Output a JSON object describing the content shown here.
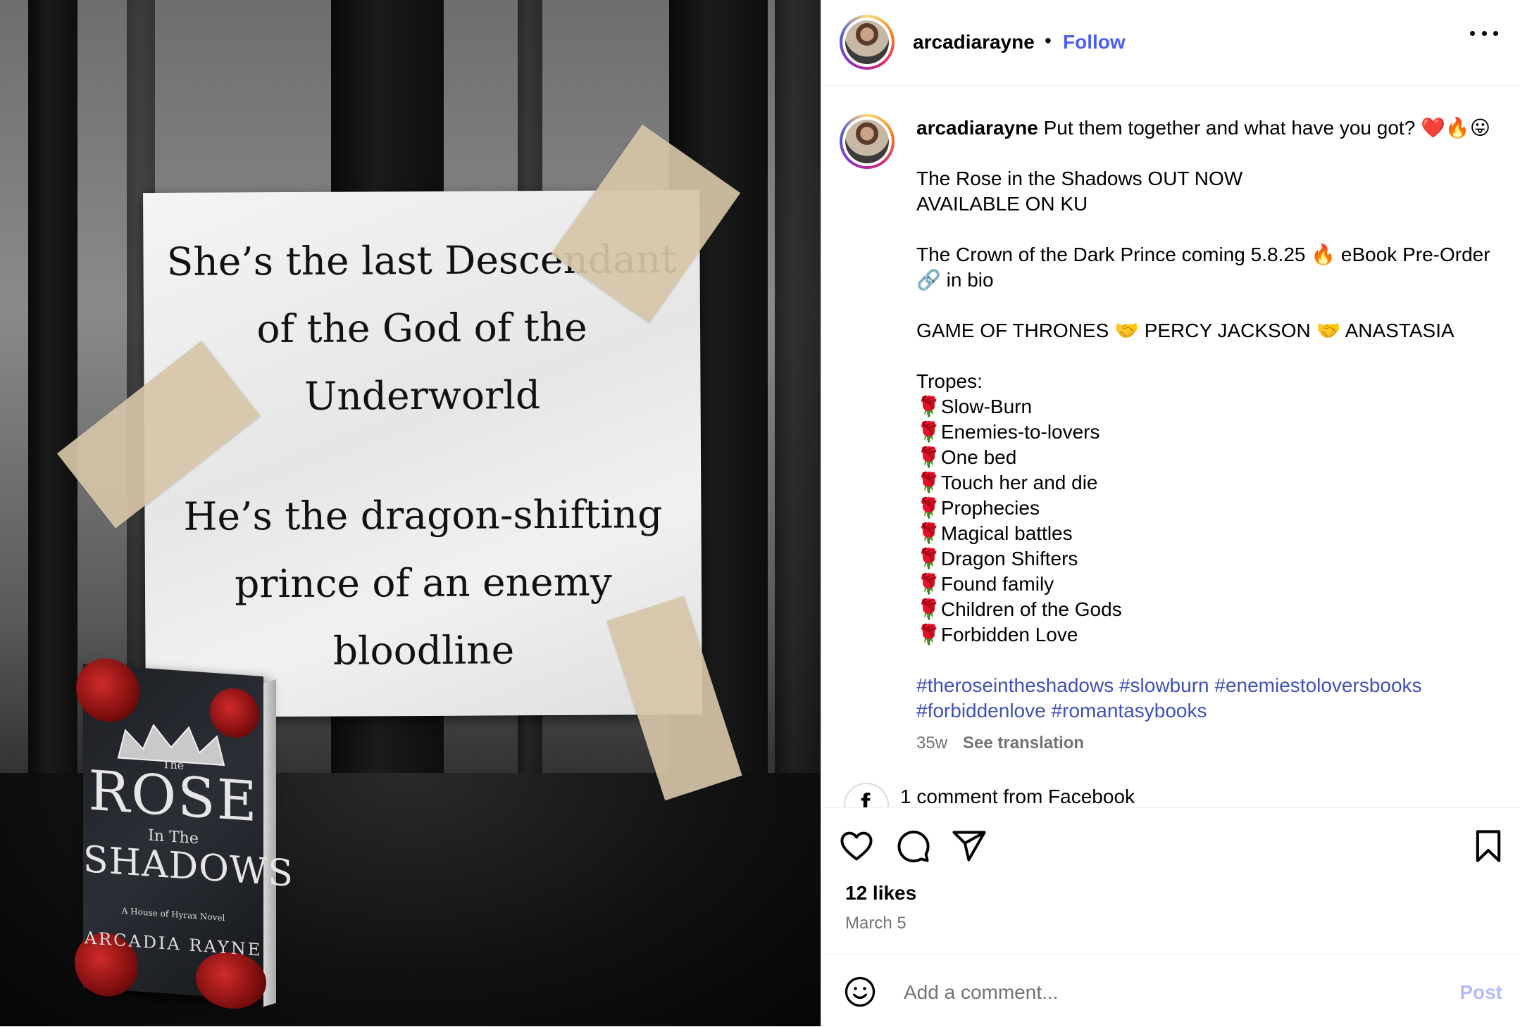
{
  "image": {
    "note_lines_1": "She’s the last Descendant\nof the God of the\nUnderworld",
    "note_lines_2": "He’s the dragon-shifting\nprince of an enemy\nbloodline",
    "book": {
      "title_top": "The",
      "title_main": "ROSE",
      "title_mid": "In The",
      "title_bottom": "SHADOWS",
      "subtitle": "A House of Hyrax Novel",
      "author": "ARCADIA RAYNE"
    }
  },
  "header": {
    "username": "arcadiarayne",
    "separator": "•",
    "follow_label": "Follow"
  },
  "caption": {
    "username": "arcadiarayne",
    "line_first": "Put them together and what have you got? ❤️🔥😛",
    "line_release_1": "The Rose in the Shadows OUT NOW",
    "line_release_2": "AVAILABLE ON KU",
    "line_crown": "The Crown of the Dark Prince coming 5.8.25 🔥 eBook Pre-Order 🔗 in bio",
    "line_comp": "GAME OF THRONES 🤝 PERCY JACKSON 🤝 ANASTASIA",
    "tropes_label": "Tropes:",
    "rose_emoji": "🌹",
    "tropes": [
      "Slow-Burn",
      "Enemies-to-lovers",
      "One bed",
      "Touch her and die",
      "Prophecies",
      "Magical battles",
      "Dragon Shifters",
      "Found family",
      "Children of the Gods",
      "Forbidden Love"
    ],
    "hashtags": "#theroseintheshadows #slowburn #enemiestoloversbooks #forbiddenlove #romantasybooks",
    "age": "35w",
    "see_translation": "See translation"
  },
  "facebook_comment": "1 comment from Facebook",
  "likes": "12 likes",
  "date": "March 5",
  "comment": {
    "placeholder": "Add a comment...",
    "post_label": "Post"
  },
  "colors": {
    "follow": "#4a5df9",
    "hashtag": "#3f51b5",
    "post_disabled": "#b3bcf9",
    "muted": "#737373"
  },
  "icons": [
    "more-options-icon",
    "heart-icon",
    "comment-icon",
    "share-icon",
    "bookmark-icon",
    "facebook-icon",
    "emoji-icon"
  ]
}
